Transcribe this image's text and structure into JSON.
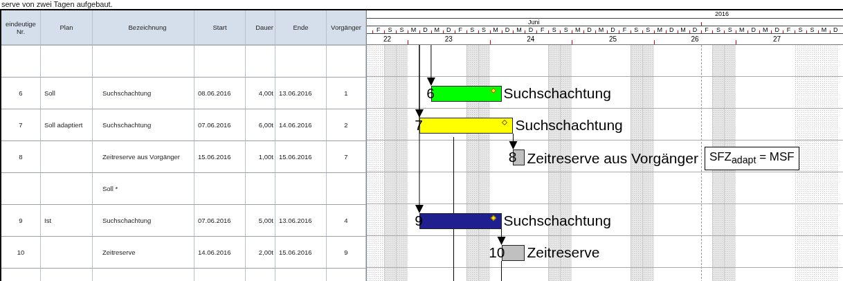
{
  "caption": "serve von zwei Tagen aufgebaut.",
  "table": {
    "columns": [
      "eindeutige Nr.",
      "Plan",
      "Bezeichnung",
      "Start",
      "Dauer",
      "Ende",
      "Vorgänger"
    ],
    "rows": [
      {},
      {
        "nr": "6",
        "plan": "Soll",
        "name": "Suchschachtung",
        "start": "08.06.2016",
        "dauer": "4,00t",
        "ende": "13.06.2016",
        "vorg": "1",
        "bar": {
          "number": "6",
          "label": "Suchschachtung",
          "color": "#00ff00",
          "milestone_filled": true,
          "linked_to_previous": false
        }
      },
      {
        "nr": "7",
        "plan": "Soll adaptiert",
        "name": "Suchschachtung",
        "start": "07.06.2016",
        "dauer": "6,00t",
        "ende": "14.06.2016",
        "vorg": "2",
        "bar": {
          "number": "7",
          "label": "Suchschachtung",
          "color": "#ffff00",
          "milestone_filled": false,
          "linked_to_previous": false
        }
      },
      {
        "nr": "8",
        "name": "Zeitreserve aus Vorgänger",
        "start": "15.06.2016",
        "dauer": "1,00t",
        "ende": "15.06.2016",
        "vorg": "7",
        "bar": {
          "number": "8",
          "label": "Zeitreserve aus Vorgänger",
          "color": "#c0c0c0",
          "linked_to_previous": true,
          "note": "SFZ$_{adapt}$ = MSF"
        }
      },
      {
        "name": "Soll *"
      },
      {
        "nr": "9",
        "plan": "Ist",
        "name": "Suchschachtung",
        "start": "07.06.2016",
        "dauer": "5,00t",
        "ende": "13.06.2016",
        "vorg": "4",
        "bar": {
          "number": "9",
          "label": "Suchschachtung",
          "color": "#1f1f8f",
          "milestone_filled": true,
          "linked_to_previous": false
        }
      },
      {
        "nr": "10",
        "name": "Zeitreserve",
        "start": "14.06.2016",
        "dauer": "2,00t",
        "ende": "15.06.2016",
        "vorg": "9",
        "bar": {
          "number": "10",
          "label": "Zeitreserve",
          "color": "#c0c0c0",
          "linked_to_previous": true
        }
      },
      {}
    ]
  },
  "timeline": {
    "year": "2016",
    "month": "Juni",
    "days": [
      "F",
      "S",
      "S",
      "M",
      "D",
      "M",
      "D",
      "F",
      "S",
      "S",
      "M",
      "D",
      "M",
      "D",
      "F",
      "S",
      "S",
      "M",
      "D",
      "M",
      "D",
      "F",
      "S",
      "S",
      "M",
      "D",
      "M",
      "D",
      "F",
      "S",
      "S",
      "M",
      "D",
      "M",
      "D",
      "F",
      "S",
      "S",
      "M",
      "D"
    ],
    "weeks": [
      "22",
      "23",
      "24",
      "25",
      "26",
      "27"
    ]
  }
}
